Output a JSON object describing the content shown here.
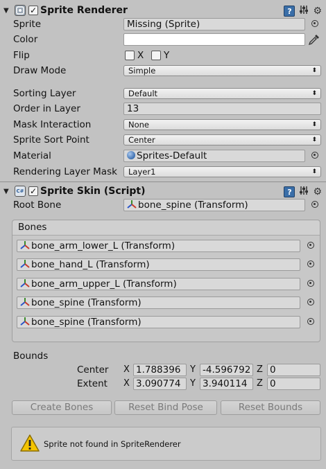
{
  "sprite_renderer": {
    "title": "Sprite Renderer",
    "enabled_mark": "✓",
    "help_icon": "?",
    "fields": {
      "sprite": {
        "label": "Sprite",
        "value": "Missing (Sprite)"
      },
      "color": {
        "label": "Color"
      },
      "flip": {
        "label": "Flip",
        "x_label": "X",
        "y_label": "Y"
      },
      "draw_mode": {
        "label": "Draw Mode",
        "value": "Simple"
      },
      "sorting_layer": {
        "label": "Sorting Layer",
        "value": "Default"
      },
      "order_in_layer": {
        "label": "Order in Layer",
        "value": "13"
      },
      "mask_interaction": {
        "label": "Mask Interaction",
        "value": "None"
      },
      "sprite_sort_point": {
        "label": "Sprite Sort Point",
        "value": "Center"
      },
      "material": {
        "label": "Material",
        "value": "Sprites-Default"
      },
      "rendering_layer_mask": {
        "label": "Rendering Layer Mask",
        "value": "Layer1"
      }
    }
  },
  "sprite_skin": {
    "title": "Sprite Skin (Script)",
    "enabled_mark": "✓",
    "help_icon": "?",
    "script_icon_text": "C#",
    "root_bone": {
      "label": "Root Bone",
      "value": "bone_spine (Transform)"
    },
    "bones_header": "Bones",
    "bones": [
      "bone_arm_lower_L (Transform)",
      "bone_hand_L (Transform)",
      "bone_arm_upper_L (Transform)",
      "bone_spine (Transform)",
      "bone_spine (Transform)"
    ],
    "bounds": {
      "label": "Bounds",
      "center": {
        "label": "Center",
        "x": "1.788396",
        "y": "-4.596792",
        "z": "0"
      },
      "extent": {
        "label": "Extent",
        "x": "3.090774",
        "y": "3.940114",
        "z": "0"
      },
      "axis_x": "X",
      "axis_y": "Y",
      "axis_z": "Z"
    },
    "buttons": {
      "create_bones": "Create Bones",
      "reset_bind_pose": "Reset Bind Pose",
      "reset_bounds": "Reset Bounds"
    },
    "warning": "Sprite not found in SpriteRenderer"
  },
  "colors": {
    "panel_bg": "#c2c2c2",
    "field_bg": "#d9d9d9",
    "help_blue": "#3a6ea8",
    "warning_yellow": "#f4c400"
  }
}
